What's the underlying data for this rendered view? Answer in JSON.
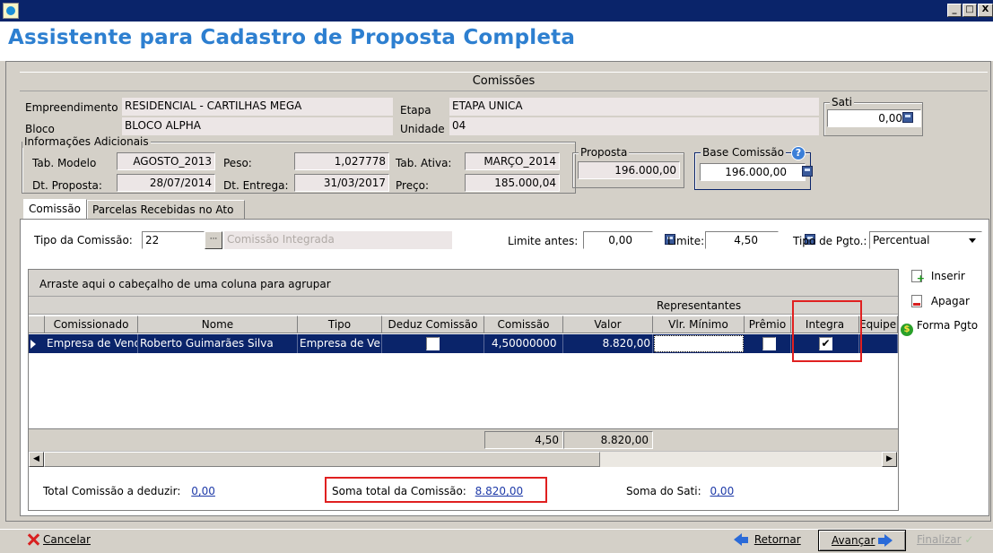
{
  "window": {
    "title_bar_text": "",
    "minimize_glyph": "_",
    "restore_glyph": "□",
    "close_glyph": "X"
  },
  "app_title": "Assistente para Cadastro de Proposta Completa",
  "section_title": "Comissões",
  "header": {
    "empreendimento_label": "Empreendimento",
    "empreendimento_value": "RESIDENCIAL - CARTILHAS MEGA",
    "etapa_label": "Etapa",
    "etapa_value": "ETAPA UNICA",
    "bloco_label": "Bloco",
    "bloco_value": "BLOCO ALPHA",
    "unidade_label": "Unidade",
    "unidade_value": "04",
    "sati_title": "Sati",
    "sati_value": "0,00"
  },
  "info": {
    "group_title": "Informações Adicionais",
    "tab_modelo_label": "Tab. Modelo",
    "tab_modelo_value": "AGOSTO_2013",
    "peso_label": "Peso:",
    "peso_value": "1,027778",
    "tab_ativa_label": "Tab. Ativa:",
    "tab_ativa_value": "MARÇO_2014",
    "dt_proposta_label": "Dt. Proposta:",
    "dt_proposta_value": "28/07/2014",
    "dt_entrega_label": "Dt. Entrega:",
    "dt_entrega_value": "31/03/2017",
    "preco_label": "Preço:",
    "preco_value": "185.000,04",
    "proposta_title": "Proposta",
    "proposta_value": "196.000,00",
    "base_comissao_title": "Base Comissão",
    "base_comissao_value": "196.000,00"
  },
  "tabs": [
    {
      "label": "Comissão"
    },
    {
      "label": "Parcelas Recebidas no Ato"
    }
  ],
  "commission": {
    "tipo_label": "Tipo da Comissão:",
    "tipo_code": "22",
    "tipo_button": "···",
    "tipo_desc": "Comissão Integrada",
    "limite_antes_label": "Limite antes:",
    "limite_antes_value": "0,00",
    "limite_label": "Limite:",
    "limite_value": "4,50",
    "tipo_pgto_label": "Tipo de Pgto.:",
    "tipo_pgto_value": "Percentual"
  },
  "grid": {
    "group_hint": "Arraste aqui o cabeçalho de uma coluna para agrupar",
    "band_label": "Representantes",
    "columns": [
      "Comissionado",
      "Nome",
      "Tipo",
      "Deduz Comissão",
      "Comissão",
      "Valor",
      "Vlr. Mínimo",
      "Prêmio",
      "Integra",
      "Equipe"
    ],
    "row": {
      "comissionado": "Empresa de Vend",
      "nome": "Roberto Guimarães Silva",
      "tipo": "Empresa de Ve",
      "deduz": false,
      "comissao": "4,50000000",
      "valor": "8.820,00",
      "vlr_minimo": "",
      "premio": false,
      "integra": true,
      "integra_glyph": "✔"
    },
    "footer_comissao": "4,50",
    "footer_valor": "8.820,00"
  },
  "side_actions": {
    "inserir": "Inserir",
    "apagar": "Apagar",
    "forma_pgto": "Forma Pgto"
  },
  "totals": {
    "total_deduzir_label": "Total Comissão a deduzir:",
    "total_deduzir_value": "0,00",
    "soma_total_label": "Soma total da Comissão:",
    "soma_total_value": "8.820,00",
    "soma_sati_label": "Soma do Sati:",
    "soma_sati_value": "0,00"
  },
  "bottom": {
    "cancelar": "Cancelar",
    "retornar": "Retornar",
    "avancar": "Avançar",
    "finalizar": "Finalizar"
  },
  "colors": {
    "title_blue": "#2d7fd0",
    "selection": "#0a246a",
    "highlight_red": "#e02020",
    "link_blue": "#1e3aa8"
  }
}
